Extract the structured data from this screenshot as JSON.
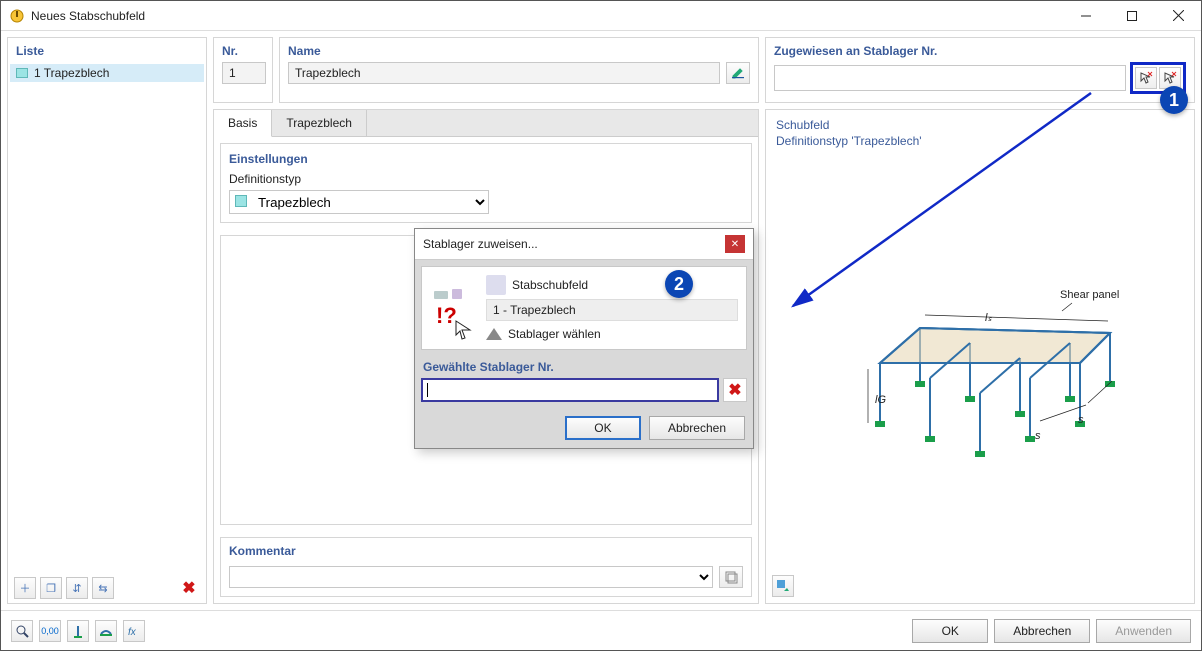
{
  "window": {
    "title": "Neues Stabschubfeld"
  },
  "list": {
    "header": "Liste",
    "items": [
      "1  Trapezblech"
    ]
  },
  "leftToolbar": {
    "t1": "＋",
    "t2": "❐",
    "t3": "⇵",
    "t4": "⇆",
    "del": "✖"
  },
  "nr": {
    "header": "Nr.",
    "value": "1"
  },
  "name": {
    "header": "Name",
    "value": "Trapezblech"
  },
  "zugewiesen": {
    "header": "Zugewiesen an Stablager Nr."
  },
  "callouts": {
    "one": "1",
    "two": "2"
  },
  "tabs": {
    "basis": "Basis",
    "trapez": "Trapezblech"
  },
  "settings": {
    "header": "Einstellungen",
    "defLabel": "Definitionstyp",
    "defValue": "Trapezblech"
  },
  "kommentar": {
    "header": "Kommentar"
  },
  "preview": {
    "line1": "Schubfeld",
    "line2": "Definitionstyp 'Trapezblech'",
    "label": "Shear panel",
    "ls": "lₛ",
    "lg": "lG",
    "s": "s"
  },
  "subdialog": {
    "title": "Stablager zuweisen...",
    "stabschubfeld": "Stabschubfeld",
    "item": "1 - Trapezblech",
    "choose": "Stablager wählen",
    "selLabel": "Gewählte Stablager Nr.",
    "ok": "OK",
    "cancel": "Abbrechen"
  },
  "footer": {
    "ok": "OK",
    "cancel": "Abbrechen",
    "apply": "Anwenden"
  }
}
